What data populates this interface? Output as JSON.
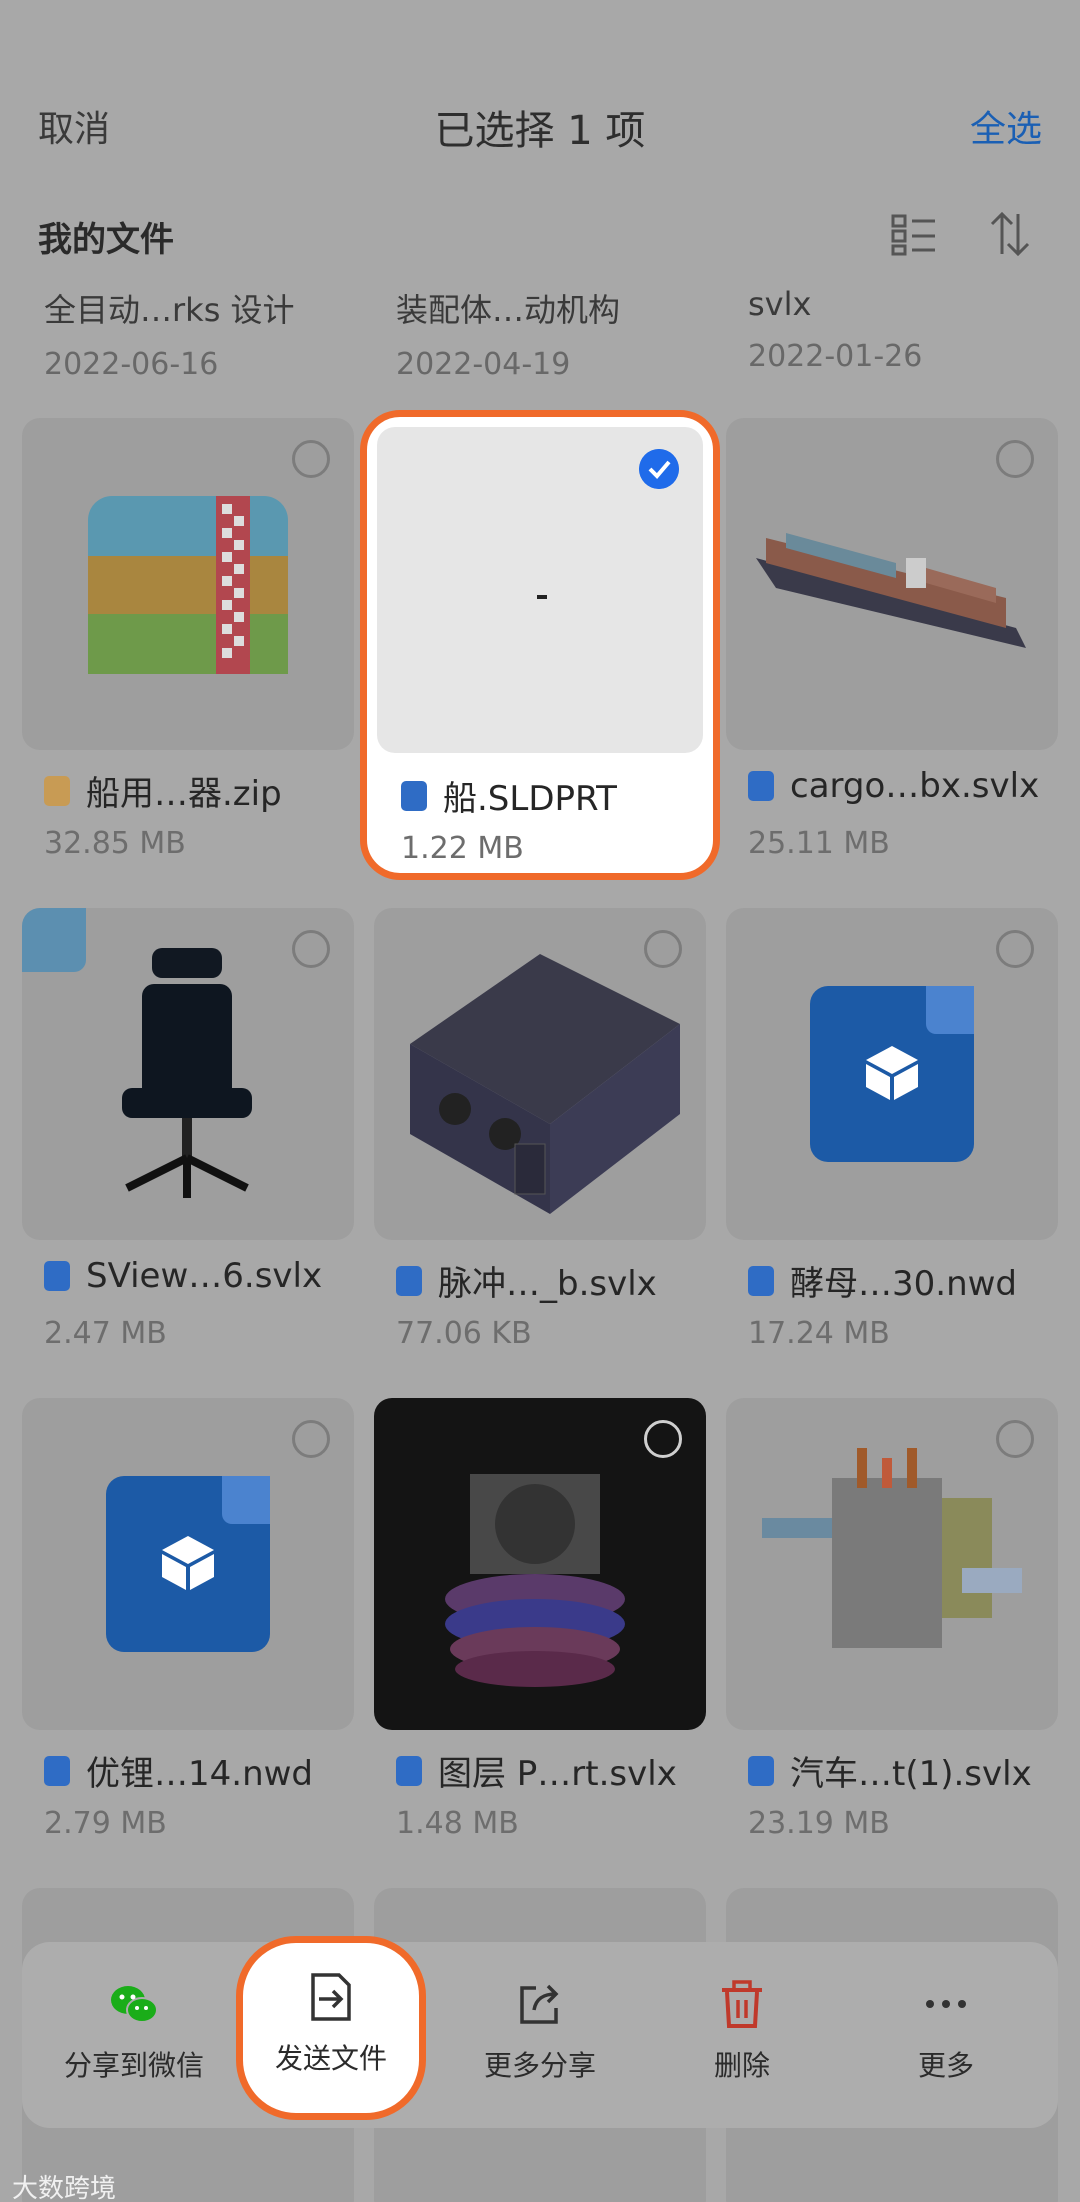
{
  "header": {
    "cancel": "取消",
    "title": "已选择 1 项",
    "select_all": "全选"
  },
  "section": {
    "title": "我的文件"
  },
  "previous_row": [
    {
      "name": "全目动…rks 设计",
      "date": "2022-06-16"
    },
    {
      "name": "装配体…动机构",
      "date": "2022-04-19"
    },
    {
      "name": "svlx",
      "date": "2022-01-26"
    }
  ],
  "files": [
    {
      "name": "船用…器.zip",
      "size": "32.85 MB",
      "icon": "zip-icon",
      "selected": false
    },
    {
      "name": "船.SLDPRT",
      "size": "1.22 MB",
      "icon": "model-file-icon",
      "selected": true
    },
    {
      "name": "cargo…bx.svlx",
      "size": "25.11 MB",
      "icon": "model-file-icon",
      "selected": false
    },
    {
      "name": "SView…6.svlx",
      "size": "2.47 MB",
      "icon": "model-file-icon",
      "selected": false
    },
    {
      "name": "脉冲…_b.svlx",
      "size": "77.06 KB",
      "icon": "model-file-icon",
      "selected": false
    },
    {
      "name": "酵母…30.nwd",
      "size": "17.24 MB",
      "icon": "model-file-icon",
      "selected": false
    },
    {
      "name": "优锂…14.nwd",
      "size": "2.79 MB",
      "icon": "model-file-icon",
      "selected": false
    },
    {
      "name": "图层 P…rt.svlx",
      "size": "1.48 MB",
      "icon": "model-file-icon",
      "selected": false
    },
    {
      "name": "汽车…t(1).svlx",
      "size": "23.19 MB",
      "icon": "model-file-icon",
      "selected": false
    }
  ],
  "actions": {
    "share_wechat": "分享到微信",
    "send_file": "发送文件",
    "more_share": "更多分享",
    "delete": "删除",
    "more": "更多"
  },
  "watermark": "大数跨境",
  "colors": {
    "accent": "#1f6bea",
    "highlight": "#f06a2a",
    "delete": "#c0392b",
    "wechat": "#1aad19"
  }
}
